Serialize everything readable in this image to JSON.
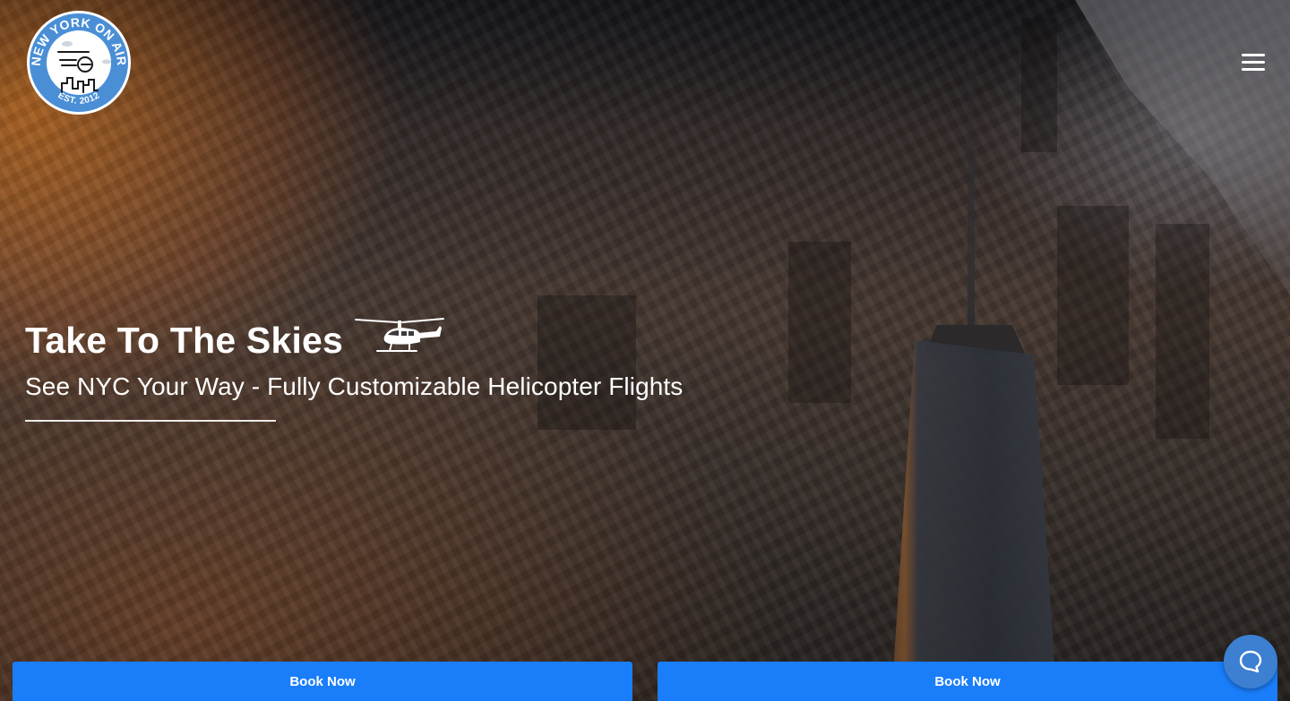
{
  "brand": {
    "logo_ring_text": "NEW YORK ON AIR",
    "logo_est_text": "EST. 2012",
    "logo_color": "#4a8fd6"
  },
  "header": {
    "menu_icon": "hamburger-menu-icon"
  },
  "hero": {
    "title": "Take To The Skies",
    "subtitle": "See NYC Your Way - Fully Customizable Helicopter Flights",
    "title_icon": "helicopter-icon"
  },
  "actions": {
    "book_left_label": "Book Now",
    "book_right_label": "Book Now",
    "button_color": "#1a7efb"
  },
  "chat": {
    "icon": "chat-bubble-icon",
    "color": "#3d7fd1"
  }
}
